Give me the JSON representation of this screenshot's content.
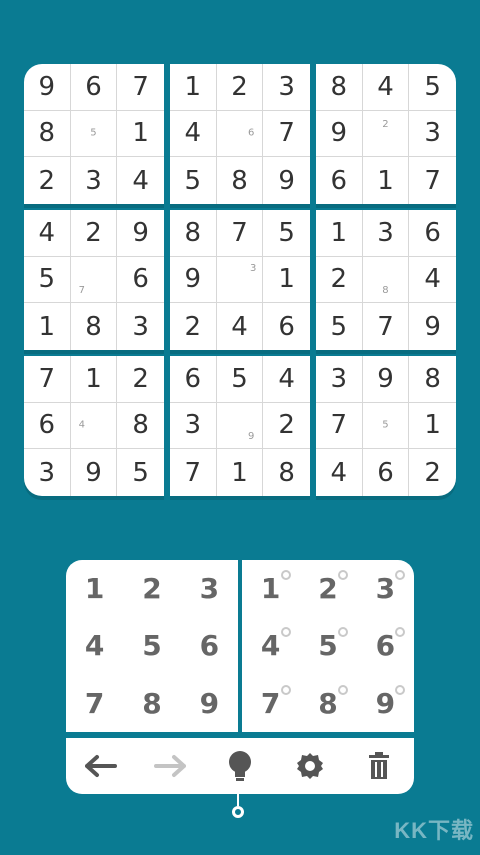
{
  "board": {
    "boxes": [
      {
        "cells": [
          "9",
          "6",
          "7",
          "8",
          "",
          "1",
          "2",
          "3",
          "4"
        ],
        "notes": [
          [],
          [],
          [],
          [],
          [
            "5"
          ],
          [],
          [],
          [],
          []
        ]
      },
      {
        "cells": [
          "1",
          "2",
          "3",
          "4",
          "",
          "7",
          "5",
          "8",
          "9"
        ],
        "notes": [
          [],
          [],
          [],
          [],
          [
            "6"
          ],
          [],
          [],
          [],
          []
        ]
      },
      {
        "cells": [
          "8",
          "4",
          "5",
          "9",
          "",
          "3",
          "6",
          "1",
          "7"
        ],
        "notes": [
          [],
          [],
          [],
          [],
          [
            "2"
          ],
          [],
          [],
          [],
          []
        ]
      },
      {
        "cells": [
          "4",
          "2",
          "9",
          "5",
          "",
          "6",
          "1",
          "8",
          "3"
        ],
        "notes": [
          [],
          [],
          [],
          [],
          [
            "7"
          ],
          [],
          [],
          [],
          []
        ]
      },
      {
        "cells": [
          "8",
          "7",
          "5",
          "9",
          "",
          "1",
          "2",
          "4",
          "6"
        ],
        "notes": [
          [],
          [],
          [],
          [],
          [
            "3"
          ],
          [],
          [],
          [],
          []
        ]
      },
      {
        "cells": [
          "1",
          "3",
          "6",
          "2",
          "",
          "4",
          "5",
          "7",
          "9"
        ],
        "notes": [
          [],
          [],
          [],
          [],
          [
            "8"
          ],
          [],
          [],
          [],
          []
        ]
      },
      {
        "cells": [
          "7",
          "1",
          "2",
          "6",
          "",
          "8",
          "3",
          "9",
          "5"
        ],
        "notes": [
          [],
          [],
          [],
          [],
          [
            "4"
          ],
          [],
          [],
          [],
          []
        ]
      },
      {
        "cells": [
          "6",
          "5",
          "4",
          "3",
          "",
          "2",
          "7",
          "1",
          "8"
        ],
        "notes": [
          [],
          [],
          [],
          [],
          [
            "9"
          ],
          [],
          [],
          [],
          []
        ]
      },
      {
        "cells": [
          "3",
          "9",
          "8",
          "7",
          "",
          "1",
          "4",
          "6",
          "2"
        ],
        "notes": [
          [],
          [],
          [],
          [],
          [
            "5"
          ],
          [],
          [],
          [],
          []
        ]
      }
    ]
  },
  "number_pad": [
    "1",
    "2",
    "3",
    "4",
    "5",
    "6",
    "7",
    "8",
    "9"
  ],
  "notes_pad": [
    "1",
    "2",
    "3",
    "4",
    "5",
    "6",
    "7",
    "8",
    "9"
  ],
  "toolbar": {
    "undo_icon": "arrow-left-icon",
    "redo_icon": "arrow-right-icon",
    "hint_icon": "lightbulb-icon",
    "settings_icon": "gear-icon",
    "delete_icon": "trash-icon"
  },
  "colors": {
    "background": "#0a7b92",
    "cell_bg": "#ffffff",
    "digit": "#333333",
    "note": "#9a9a9a"
  },
  "watermark": "KK下载"
}
